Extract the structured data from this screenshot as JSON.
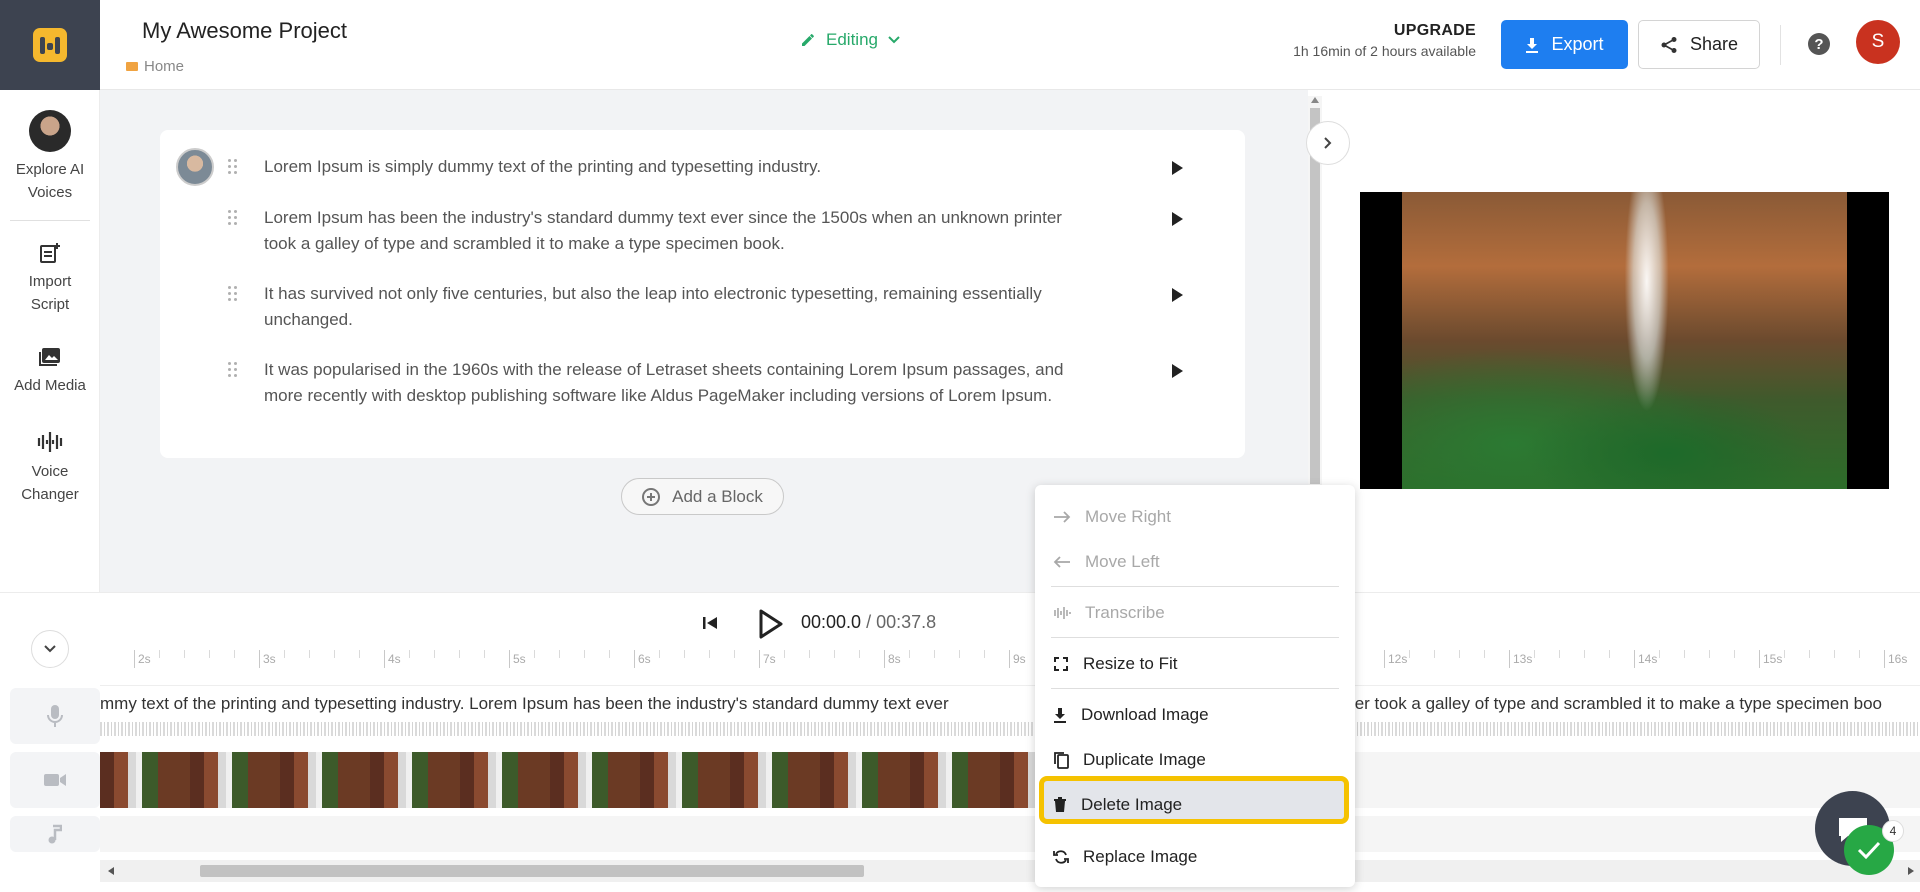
{
  "header": {
    "project_title": "My Awesome Project",
    "breadcrumb": "Home",
    "mode_label": "Editing",
    "upgrade_title": "UPGRADE",
    "upgrade_sub": "1h 16min of 2 hours available",
    "export_label": "Export",
    "share_label": "Share",
    "help_label": "?",
    "user_initial": "S"
  },
  "sidebar": {
    "items": [
      {
        "label": "Explore AI Voices",
        "icon": "ai-voice-avatar"
      },
      {
        "label": "Import Script",
        "icon": "import-script-icon"
      },
      {
        "label": "Add Media",
        "icon": "image-icon"
      },
      {
        "label": "Voice Changer",
        "icon": "waveform-icon"
      }
    ]
  },
  "script": {
    "blocks": [
      "Lorem Ipsum is simply dummy text of the printing and typesetting industry.",
      "Lorem Ipsum has been the industry's standard dummy text ever since the 1500s when an unknown printer took a galley of type and scrambled it to make a type specimen book.",
      "It has survived not only five centuries, but also the leap into electronic typesetting, remaining essentially unchanged.",
      "It was popularised in the 1960s with the release of Letraset sheets containing Lorem Ipsum passages, and more recently with desktop publishing software like Aldus PageMaker including versions of Lorem Ipsum."
    ],
    "add_block_label": "Add a Block"
  },
  "transport": {
    "current_time": "00:00.0",
    "separator": " / ",
    "total_time": "00:37.8"
  },
  "timeline": {
    "ruler_labels": [
      "2s",
      "3s",
      "4s",
      "5s",
      "6s",
      "7s",
      "8s",
      "9s",
      "12s",
      "13s",
      "14s",
      "15s",
      "16s"
    ],
    "audio_text_left": "mmy text of the printing and typesetting industry. Lorem Ipsum has been the industry's standard dummy text ever",
    "audio_text_right": "ter took a galley of type and scrambled it to make a type specimen boo"
  },
  "context_menu": {
    "items": [
      {
        "label": "Move Right",
        "icon": "arrow-right-icon",
        "disabled": true
      },
      {
        "label": "Move Left",
        "icon": "arrow-left-icon",
        "disabled": true
      },
      {
        "label": "Transcribe",
        "icon": "transcribe-icon",
        "disabled": true
      },
      {
        "label": "Resize to Fit",
        "icon": "resize-icon",
        "disabled": false
      },
      {
        "label": "Download Image",
        "icon": "download-icon",
        "disabled": false
      },
      {
        "label": "Duplicate Image",
        "icon": "duplicate-icon",
        "disabled": false
      },
      {
        "label": "Delete Image",
        "icon": "trash-icon",
        "disabled": false,
        "highlighted": true
      },
      {
        "label": "Replace Image",
        "icon": "replace-icon",
        "disabled": false
      }
    ]
  },
  "chat": {
    "badge_count": "4"
  },
  "colors": {
    "accent_blue": "#1e7ef0",
    "editing_green": "#27a96a",
    "highlight_yellow": "#f5c200",
    "avatar_red": "#c9321f",
    "logo_yellow": "#f5b82e",
    "dark_panel": "#3d4350"
  }
}
